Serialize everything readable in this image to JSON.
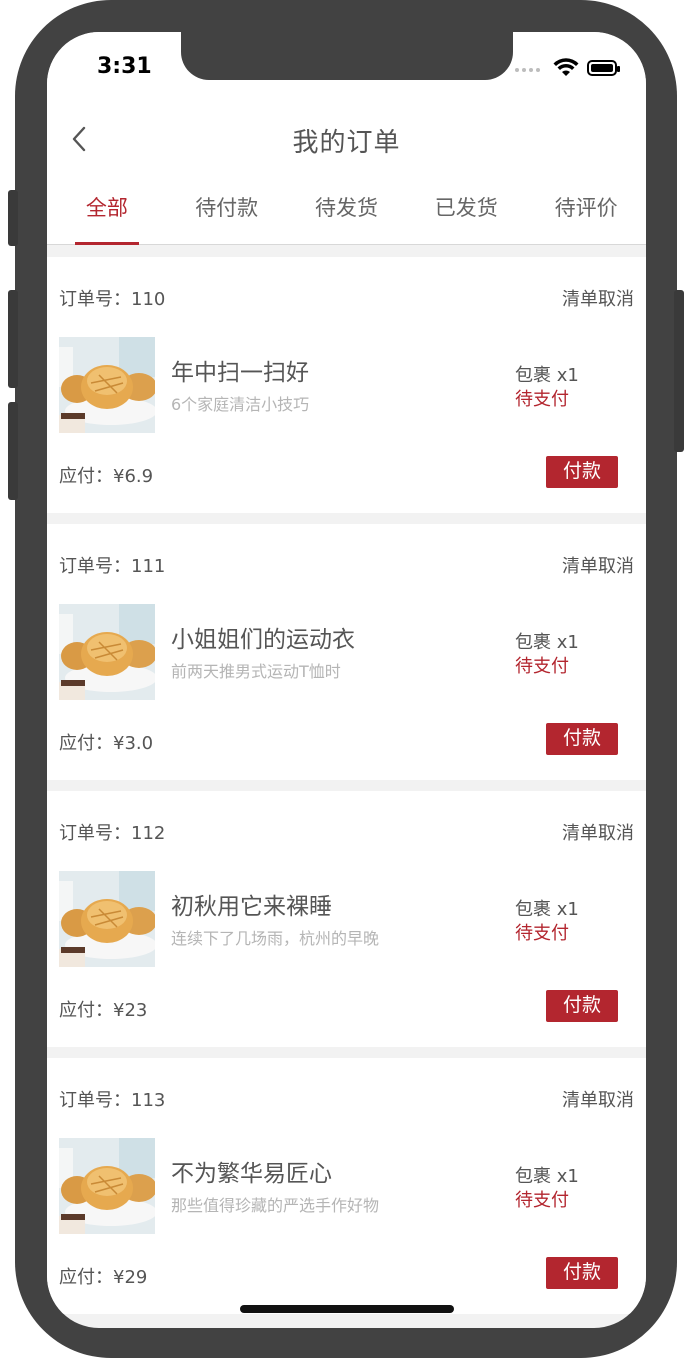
{
  "status_bar": {
    "time": "3:31"
  },
  "header": {
    "title": "我的订单"
  },
  "tabs": [
    {
      "label": "全部",
      "active": true
    },
    {
      "label": "待付款",
      "active": false
    },
    {
      "label": "待发货",
      "active": false
    },
    {
      "label": "已发货",
      "active": false
    },
    {
      "label": "待评价",
      "active": false
    }
  ],
  "order_labels": {
    "order_no_prefix": "订单号：",
    "cancel": "清单取消",
    "amount_prefix": "应付：",
    "pay_button": "付款"
  },
  "orders": [
    {
      "number": "110",
      "title": "年中扫一扫好",
      "desc": "6个家庭清洁小技巧",
      "pack": "包裹 x1",
      "status": "待支付",
      "amount": "¥6.9"
    },
    {
      "number": "111",
      "title": "小姐姐们的运动衣",
      "desc": "前两天推男式运动T恤时",
      "pack": "包裹 x1",
      "status": "待支付",
      "amount": "¥3.0"
    },
    {
      "number": "112",
      "title": "初秋用它来裸睡",
      "desc": "连续下了几场雨，杭州的早晚",
      "pack": "包裹 x1",
      "status": "待支付",
      "amount": "¥23"
    },
    {
      "number": "113",
      "title": "不为繁华易匠心",
      "desc": "那些值得珍藏的严选手作好物",
      "pack": "包裹 x1",
      "status": "待支付",
      "amount": "¥29"
    }
  ],
  "colors": {
    "accent": "#b3262f",
    "frame": "#424242",
    "background": "#f2f2f2"
  }
}
